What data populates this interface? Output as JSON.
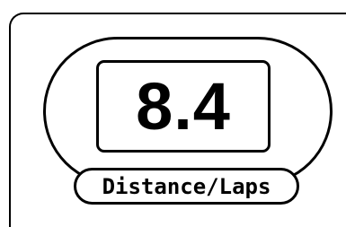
{
  "display": {
    "value": "8.4",
    "label": "Distance/Laps"
  }
}
